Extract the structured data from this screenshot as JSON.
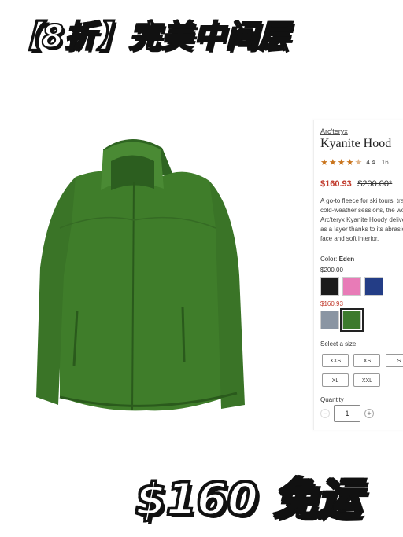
{
  "overlay": {
    "headline": "【8折】完美中间层",
    "price_banner": "$160 免运"
  },
  "product": {
    "brand": "Arc'teryx",
    "title": "Kyanite Hood",
    "rating_value": "4.4",
    "rating_count": "16",
    "rating_stars": 4.4,
    "sale_price": "$160.93",
    "original_price": "$200.00*",
    "description": "A go-to fleece for ski tours, trail runs and cold-weather sessions, the women's Arc'teryx Kyanite Hoody delivers warmth as a layer thanks to its abrasion-resistant face and soft interior.",
    "color_label": "Color:",
    "color_value": "Eden",
    "price_group_1": "$200.00",
    "price_group_2": "$160.93",
    "swatches_group_1": [
      {
        "name": "black",
        "color": "#1b1b1b"
      },
      {
        "name": "pink",
        "color": "#e87bb7"
      },
      {
        "name": "navy",
        "color": "#233d86"
      }
    ],
    "swatches_group_2": [
      {
        "name": "grey",
        "color": "#8a95a3"
      },
      {
        "name": "eden-green",
        "color": "#3c7a2c"
      }
    ],
    "size_label": "Select a size",
    "sizes": [
      "XXS",
      "XS",
      "S",
      "XL",
      "XXL"
    ],
    "quantity_label": "Quantity",
    "quantity": "1"
  },
  "colors": {
    "sale_red": "#c0392b",
    "star_orange": "#c9741c",
    "jacket_green": "#3f7d2a"
  }
}
